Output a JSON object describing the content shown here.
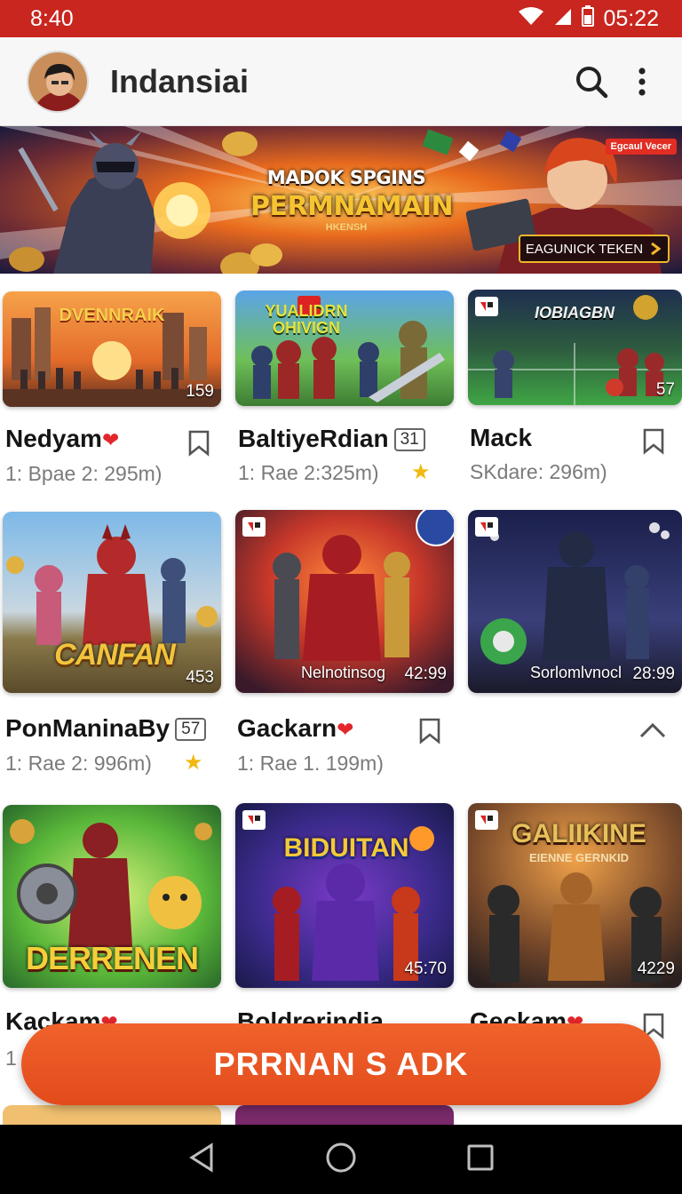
{
  "status_bar": {
    "time": "8:40",
    "clock": "05:22",
    "icons": [
      "wifi-icon",
      "signal-icon",
      "battery-icon"
    ]
  },
  "app_bar": {
    "title": "Indansiai",
    "avatar": "avatar",
    "search_icon": "search-icon",
    "menu_icon": "more-vert-icon"
  },
  "banner": {
    "title_line1": "MADOK SPGINS",
    "title_line2": "PERMNAMAIN",
    "subtitle": "HKENSH",
    "tag": "Egcaul Vecer",
    "cta_label": "EAGUNICK TEKEN"
  },
  "cards": [
    {
      "title": "Nedyam",
      "heart": true,
      "meta": "1: Bpae 2: 295m)",
      "duration": "159",
      "art_text": "DVENNRAIK",
      "bookmark": true
    },
    {
      "title": "BaltiyeRdian",
      "badge": "31",
      "meta": "1: Rae 2:325m)",
      "star": true,
      "art_text": "YUALIDRN OHIVIGN"
    },
    {
      "title": "Mack",
      "meta": "SKdare: 296m)",
      "duration": "57",
      "art_text": "IOBIAGBN",
      "bookmark": true
    },
    {
      "title": "PonManinaBy",
      "badge": "57",
      "meta": "1: Rae 2: 996m)",
      "star": true,
      "duration": "453",
      "art_text": "CANFAN"
    },
    {
      "title": "Gackarn",
      "heart": true,
      "meta": "1: Rae 1. 199m)",
      "duration": "42:99",
      "overlay": "Nelnotinsog",
      "bookmark": true
    },
    {
      "title": "",
      "meta": "",
      "duration": "28:99",
      "overlay": "Sorlomlvnocl",
      "chevron": true
    },
    {
      "title": "Kackam",
      "heart": true,
      "meta": "1",
      "art_text": "DERRENEN"
    },
    {
      "title": "Boldrerindia",
      "meta": "",
      "duration": "45:70",
      "art_text": "BIDUITAN"
    },
    {
      "title": "Geckam",
      "heart": true,
      "meta": "",
      "duration": "4229",
      "art_text": "GALIIKINE",
      "art_sub": "EIENNE GERNKID",
      "bookmark": true
    }
  ],
  "cta": {
    "label": "PRRNAN S ADK"
  },
  "nav": {
    "back": "back-icon",
    "home": "home-icon",
    "recents": "recents-icon"
  },
  "colors": {
    "status": "#c8261f",
    "accent": "#e24b1b",
    "heart": "#e3262c",
    "star": "#f1b911"
  }
}
